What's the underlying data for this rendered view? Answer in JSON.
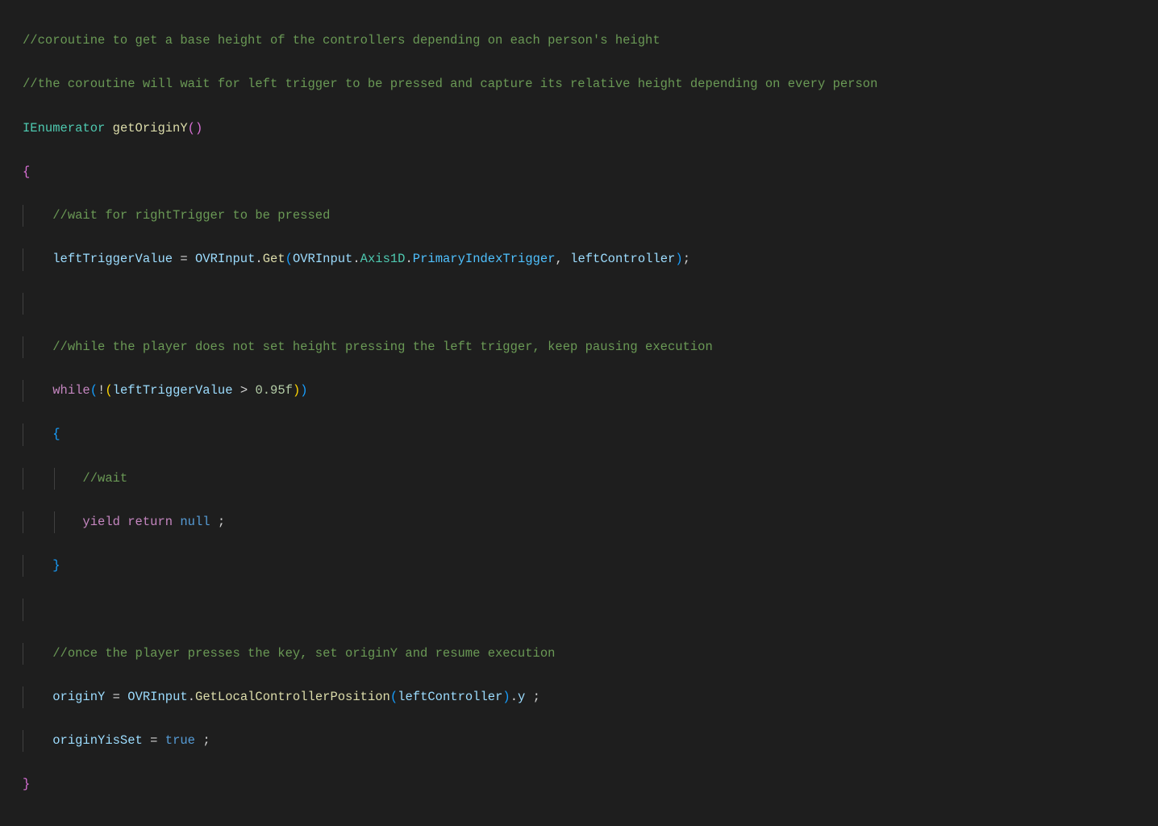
{
  "code": {
    "c1": "//coroutine to get a base height of the controllers depending on each person's height",
    "c2": "//the coroutine will wait for left trigger to be pressed and capture its relative height depending on every person",
    "returnType": "IEnumerator",
    "methodName": "getOriginY",
    "c3": "//wait for rightTrigger to be pressed",
    "var_leftTriggerValue": "leftTriggerValue",
    "cls_OVRInput": "OVRInput",
    "m_Get": "Get",
    "enum_Axis1D": "Axis1D",
    "enum_PrimaryIndexTrigger": "PrimaryIndexTrigger",
    "var_leftController": "leftController",
    "c4": "//while the player does not set height pressing the left trigger, keep pausing execution",
    "kw_while": "while",
    "lit_threshold": "0.95f",
    "c5": "//wait",
    "kw_yield": "yield",
    "kw_return": "return",
    "kw_null": "null",
    "c6": "//once the player presses the key, set originY and resume execution",
    "var_originY": "originY",
    "m_GetLocalControllerPosition": "GetLocalControllerPosition",
    "prop_y": "y",
    "var_originYisSet": "originYisSet",
    "lit_true": "true"
  }
}
